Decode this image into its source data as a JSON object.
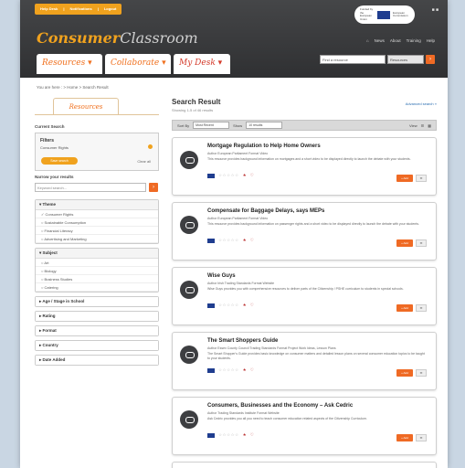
{
  "header": {
    "topbar": [
      "Help Desk",
      "Notifications",
      "Logout"
    ],
    "eu_text": "Funded by the European Union",
    "eu_label": "European Commission",
    "logo_bold": "Consumer",
    "logo_thin": "Classroom",
    "nav": [
      "News",
      "About",
      "Training",
      "Help"
    ],
    "tabs": [
      "Resources",
      "Collaborate",
      "My Desk"
    ],
    "search_placeholder": "Find a resource",
    "search_select": "Resources"
  },
  "breadcrumb": "You are here : > Home > Search Result",
  "left": {
    "resources_tab": "Resources",
    "current_search": "Current Search",
    "filters_title": "Filters",
    "filters_value": "Consumer Rights",
    "save_search": "Save search",
    "clear_all": "Clear all",
    "narrow": "Narrow your results",
    "keyword_placeholder": "Keyword search...",
    "facets": [
      {
        "title": "Theme",
        "items": [
          "Consumer Rights",
          "Sustainable Consumption",
          "Financial Literacy",
          "Advertising and Marketing"
        ]
      },
      {
        "title": "Subject",
        "items": [
          "Art",
          "Biology",
          "Business Studies",
          "Catering"
        ]
      },
      {
        "title": "Age / Stage in School",
        "items": []
      },
      {
        "title": "Rating",
        "items": []
      },
      {
        "title": "Format",
        "items": []
      },
      {
        "title": "Country",
        "items": []
      },
      {
        "title": "Date Added",
        "items": []
      }
    ]
  },
  "main": {
    "title": "Search Result",
    "subtitle": "Showing 1-5 of 46 results",
    "advanced": "Advanced search »",
    "sort_label": "Sort By",
    "sort_value": "Most Recent",
    "show_label": "Show",
    "show_value": "10 results",
    "view_label": "View",
    "results": [
      {
        "title": "Mortgage Regulation to Help Home Owners",
        "author": "Author European Parliament  Format Video",
        "desc": "This resource provides background information on mortgages and a short video to be displayed directly to launch the debate with your students."
      },
      {
        "title": "Compensate for Baggage Delays, says MEPs",
        "author": "Author European Parliament  Format Video",
        "desc": "This resource provides background information on passenger rights and a short video to be displayed directly to launch the debate with your students."
      },
      {
        "title": "Wise Guys",
        "author": "Author Irish Trading Standards  Format Website",
        "desc": "Wise Guys provides you with comprehensive resources to deliver parts of the Citizenship / PSHE curriculum to students in special schools."
      },
      {
        "title": "The Smart Shoppers Guide",
        "author": "Author Essex County Council Trading Standards  Format Project Work Ideas, Lesson Plans",
        "desc": "The Smart Shopper's Guide provides basic knowledge on consumer matters and detailed lesson plans on several consumer education topics to be taught to your students."
      },
      {
        "title": "Consumers, Businesses and the Economy – Ask Cedric",
        "author": "Author Trading Standards Institute  Format Website",
        "desc": "Ask Cedric provides you all you need to teach consumer education related aspects of the Citizenship Curriculum."
      }
    ],
    "add_label": "+ Add",
    "share_label": "✉",
    "stars": "☆☆☆☆☆"
  }
}
